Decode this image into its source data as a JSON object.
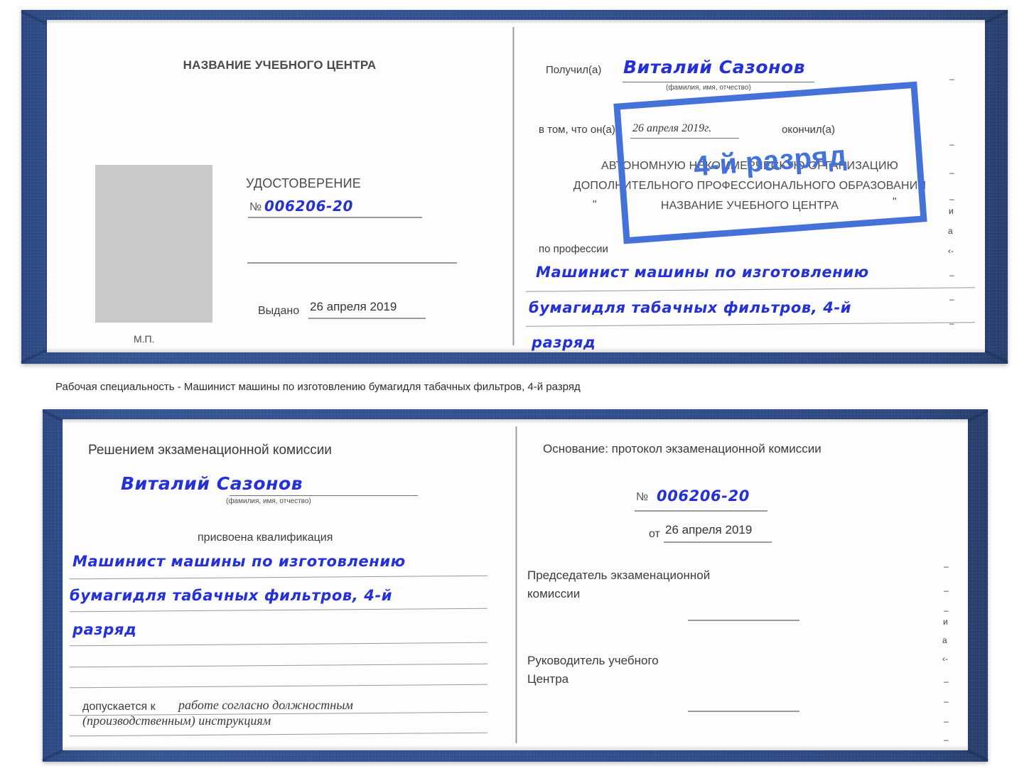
{
  "caption": "Рабочая специальность - Машинист машины по изготовлению бумагидля табачных фильтров, 4-й разряд",
  "colors": {
    "cover_blue": "#24499a",
    "ink_blue": "#2430d8",
    "stamp_blue": "#4472d8",
    "page_white": "#fdfdfd",
    "photo_gray": "#c9c9c9",
    "rule_gray": "#9a9a9a",
    "text_gray": "#3c3c3c"
  },
  "certificate_top": {
    "left_page": {
      "header": "НАЗВАНИЕ УЧЕБНОГО ЦЕНТРА",
      "photo_placeholder": "photo-placeholder",
      "title": "УДОСТОВЕРЕНИЕ",
      "number_label": "№",
      "number_value": "006206-20",
      "blank_line": "",
      "issued_label": "Выдано",
      "issued_value": "26 апреля 2019",
      "seal_label": "М.П."
    },
    "right_page": {
      "received_label": "Получил(а)",
      "received_value": "Виталий Сазонов",
      "received_hint": "(фамилия, имя, отчество)",
      "in_that_label": "в том, что он(а)",
      "completion_date": "26 апреля 2019г.",
      "finished_label": "окончил(а)",
      "org_line1": "АВТОНОМНУЮ НЕКОММЕРЧЕСКУЮ ОРГАНИЗАЦИЮ",
      "org_line2": "ДОПОЛНИТЕЛЬНОГО ПРОФЕССИОНАЛЬНОГО ОБРАЗОВАНИЯ",
      "org_quote_open": "\"",
      "org_name": "НАЗВАНИЕ УЧЕБНОГО ЦЕНТРА",
      "org_quote_close": "\"",
      "profession_label": "по профессии",
      "profession_line1": "Машинист машины по изготовлению",
      "profession_line2": "бумагидля табачных фильтров, 4-й",
      "profession_line3": "разряд",
      "stamp_text": "4-й разряд",
      "edge_fragments": [
        "–",
        "–",
        "–",
        "и",
        "а",
        "‹-",
        "–",
        "–",
        "–",
        "–"
      ]
    }
  },
  "certificate_bottom": {
    "left_page": {
      "header": "Решением экзаменационной комиссии",
      "name_value": "Виталий Сазонов",
      "name_hint": "(фамилия, имя, отчество)",
      "qualification_label": "присвоена квалификация",
      "qualification_line1": "Машинист машины по изготовлению",
      "qualification_line2": "бумагидля табачных фильтров, 4-й",
      "qualification_line3": "разряд",
      "admitted_label": "допускается к",
      "admitted_line1": "работе согласно должностным",
      "admitted_line2": "(производственным) инструкциям"
    },
    "right_page": {
      "basis_label": "Основание: протокол экзаменационной комиссии",
      "number_label": "№",
      "number_value": "006206-20",
      "date_label": "от",
      "date_value": "26 апреля 2019",
      "chairman_line1": "Председатель экзаменационной",
      "chairman_line2": "комиссии",
      "director_line1": "Руководитель учебного",
      "director_line2": "Центра",
      "edge_fragments": [
        "–",
        "–",
        "–",
        "и",
        "а",
        "‹-",
        "–",
        "–",
        "–",
        "–"
      ]
    }
  }
}
